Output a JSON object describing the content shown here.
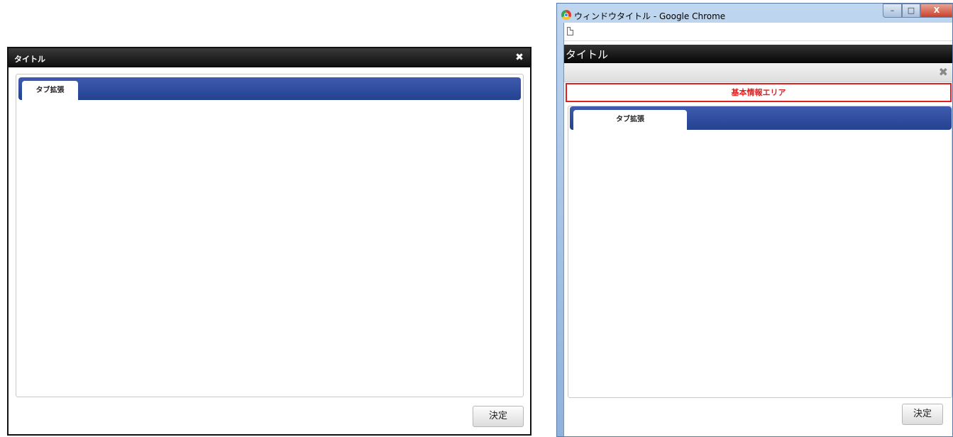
{
  "left_dialog": {
    "title": "タイトル",
    "close_glyph": "✖",
    "tabs": [
      {
        "label": "タブ拡張"
      }
    ],
    "confirm_label": "決定"
  },
  "right_window": {
    "window_title": "ウィンドウタイトル - Google Chrome",
    "window_controls": {
      "minimize": "–",
      "maximize": "□",
      "close": "X"
    },
    "dialog_title": "タイトル",
    "close_glyph": "✖",
    "info_area_label": "基本情報エリア",
    "tabs": [
      {
        "label": "タブ拡張"
      }
    ],
    "confirm_label": "決定"
  },
  "colors": {
    "tab_bar": "#2b4a9c",
    "title_bar": "#111111",
    "info_area_border": "#e02020"
  },
  "icons": {
    "chrome": "chrome-icon",
    "page": "page-icon",
    "close": "close-icon"
  }
}
